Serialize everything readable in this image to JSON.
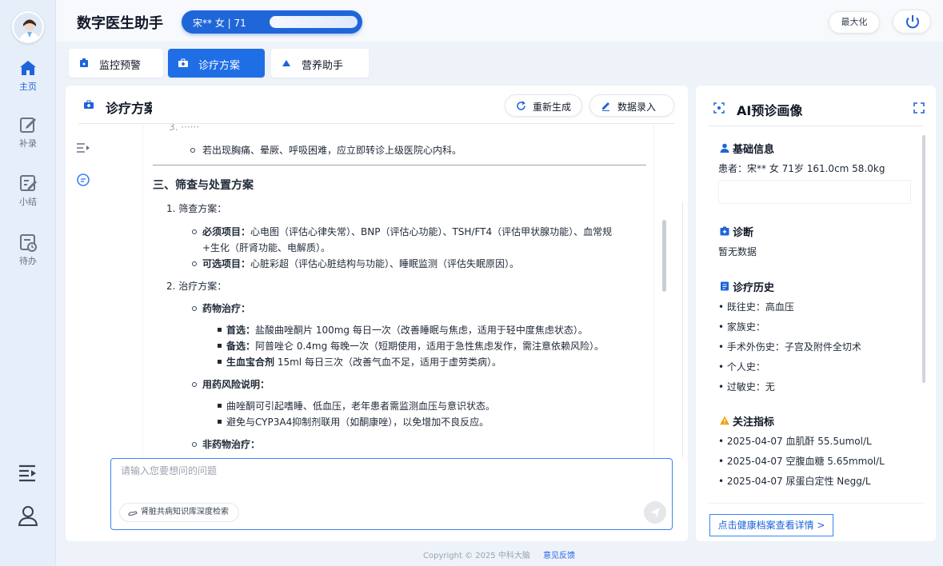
{
  "header": {
    "app_title": "数字医生助手",
    "patient": "宋**    女  |  71",
    "maximize_label": "最大化"
  },
  "nav": {
    "items": [
      {
        "label": "主页",
        "icon": "home-icon",
        "active": true
      },
      {
        "label": "补录",
        "icon": "edit-icon",
        "active": false
      },
      {
        "label": "小结",
        "icon": "summary-icon",
        "active": false
      },
      {
        "label": "待办",
        "icon": "todo-icon",
        "active": false
      }
    ]
  },
  "tabs": [
    {
      "label": "监控预警",
      "icon": "monitor-icon",
      "active": false
    },
    {
      "label": "诊疗方案",
      "icon": "kit-icon",
      "active": true
    },
    {
      "label": "营养助手",
      "icon": "nutrition-icon",
      "active": false
    }
  ],
  "main": {
    "title": "诊疗方案",
    "regenerate_label": "重新生成",
    "data_entry_label": "数据录入",
    "doc": {
      "top_item": "若出现胸痛、晕厥、呼吸困难，应立即转诊上级医院心内科。",
      "section3": "三、筛查与处置方案",
      "s1": "1. 筛查方案：",
      "required_label": "必须项目：",
      "required_text_1": "心电图（评估心律失常）、BNP（评估心功能）、TSH/FT4（评估甲状腺功能）、血常规",
      "required_text_2": "+生化（肝肾功能、电解质）。",
      "optional_label": "可选项目：",
      "optional_text": "心脏彩超（评估心脏结构与功能）、睡眠监测（评估失眠原因）。",
      "s2": "2. 治疗方案：",
      "drug_label": "药物治疗：",
      "first_label": "首选：",
      "first_text": "盐酸曲唑酮片 100mg 每日一次（改善睡眠与焦虑，适用于轻中度焦虑状态）。",
      "alt_label": "备选：",
      "alt_text": "阿普唑仑 0.4mg 每晚一次（短期使用，适用于急性焦虑发作，需注意依赖风险）。",
      "herb_label": "生血宝合剂",
      "herb_text": " 15ml 每日三次（改善气血不足，适用于虚劳类病）。",
      "risk_label": "用药风险说明：",
      "risk_1": "曲唑酮可引起嗜睡、低血压，老年患者需监测血压与意识状态。",
      "risk_2": "避免与CYP3A4抑制剂联用（如酮康唑），以免增加不良反应。",
      "nondrug_label": "非药物治疗："
    },
    "input_placeholder": "请输入您要想问的问题",
    "kb_chip": "肾脏共病知识库深度检索"
  },
  "right": {
    "title": "AI预诊画像",
    "basic_h": "基础信息",
    "basic_line": "患者：宋**  女  71岁   161.0cm   58.0kg",
    "diag_h": "诊断",
    "diag_line": "暂无数据",
    "history_h": "诊疗历史",
    "history": [
      "既往史：高血压",
      "家族史：",
      "手术外伤史：子宫及附件全切术",
      "个人史：",
      "过敏史：无"
    ],
    "focus_h": "关注指标",
    "focus": [
      "2025-04-07 血肌酐 55.5umol/L",
      "2025-04-07 空腹血糖 5.65mmol/L",
      "2025-04-07 尿蛋白定性 Negg/L"
    ],
    "link_label": "点击健康档案查看详情 >"
  },
  "footer": {
    "copyright": "Copyright © 2025 中科大脑",
    "feedback": "意见反馈"
  },
  "colors": {
    "primary": "#1f6ee6",
    "warning": "#f59e0b"
  }
}
